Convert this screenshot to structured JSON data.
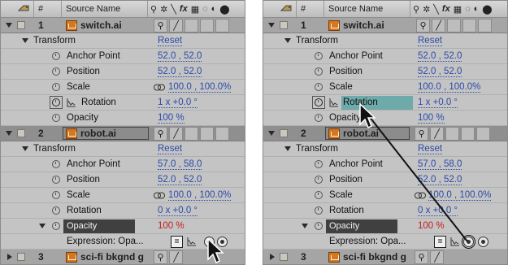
{
  "header": {
    "label_icon": "tag-icon",
    "number_col": "#",
    "source_name_col": "Source Name",
    "switch_icons": [
      "shy-icon",
      "sun-icon",
      "slash-icon",
      "fx-icon",
      "film-icon",
      "motion-blur-icon",
      "adjustment-icon",
      "3d-icon"
    ],
    "fx_label": "fx"
  },
  "left": {
    "layer1": {
      "num": "1",
      "name": "switch.ai"
    },
    "transform1": {
      "label": "Transform",
      "reset": "Reset"
    },
    "l1_props": [
      {
        "name": "Anchor Point",
        "value": "52.0 , 52.0"
      },
      {
        "name": "Position",
        "value": "52.0 , 52.0"
      },
      {
        "name": "Scale",
        "value": "100.0 , 100.0%"
      },
      {
        "name": "Rotation",
        "value": "1 x +0.0 °"
      },
      {
        "name": "Opacity",
        "value": "100 %"
      }
    ],
    "layer2": {
      "num": "2",
      "name": "robot.ai"
    },
    "transform2": {
      "label": "Transform",
      "reset": "Reset"
    },
    "l2_props": [
      {
        "name": "Anchor Point",
        "value": "57.0 , 58.0"
      },
      {
        "name": "Position",
        "value": "52.0 , 52.0"
      },
      {
        "name": "Scale",
        "value": "100.0 , 100.0%"
      },
      {
        "name": "Rotation",
        "value": "0 x +0.0 °"
      },
      {
        "name": "Opacity",
        "value": "100 %"
      }
    ],
    "expression": {
      "label": "Expression: Opa...",
      "eq": "="
    },
    "layer3": {
      "num": "3",
      "name": "sci-fi bkgnd g"
    }
  },
  "right": {
    "layer1": {
      "num": "1",
      "name": "switch.ai"
    },
    "transform1": {
      "label": "Transform",
      "reset": "Reset"
    },
    "l1_props": [
      {
        "name": "Anchor Point",
        "value": "52.0 , 52.0"
      },
      {
        "name": "Position",
        "value": "52.0 , 52.0"
      },
      {
        "name": "Scale",
        "value": "100.0 , 100.0%"
      },
      {
        "name": "Rotation",
        "value": "1 x +0.0 °"
      },
      {
        "name": "Opacity",
        "value": "100 %"
      }
    ],
    "layer2": {
      "num": "2",
      "name": "robot.ai"
    },
    "transform2": {
      "label": "Transform",
      "reset": "Reset"
    },
    "l2_props": [
      {
        "name": "Anchor Point",
        "value": "57.0 , 58.0"
      },
      {
        "name": "Position",
        "value": "52.0 , 52.0"
      },
      {
        "name": "Scale",
        "value": "100.0 , 100.0%"
      },
      {
        "name": "Rotation",
        "value": "0 x +0.0 °"
      },
      {
        "name": "Opacity",
        "value": "100 %"
      }
    ],
    "expression": {
      "label": "Expression: Opa...",
      "eq": "="
    },
    "layer3": {
      "num": "3",
      "name": "sci-fi bkgnd g"
    }
  },
  "colors": {
    "panel_bg": "#c4c4c4",
    "value_blue": "#2c4aa8",
    "value_red": "#c21f1f",
    "highlight_teal": "#6eaaaa",
    "selected_dark": "#404040"
  }
}
